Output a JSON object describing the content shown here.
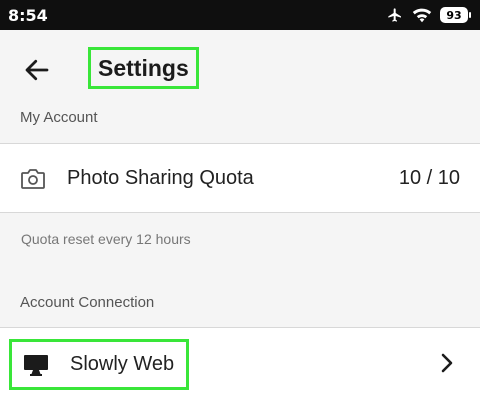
{
  "status_bar": {
    "time": "8:54",
    "battery": "93",
    "icons": [
      "airplane-icon",
      "wifi-icon",
      "battery-icon"
    ]
  },
  "header": {
    "title": "Settings",
    "back_icon": "back-arrow-icon"
  },
  "sections": {
    "my_account": {
      "label": "My Account",
      "quota_row": {
        "icon": "camera-icon",
        "label": "Photo Sharing Quota",
        "value": "10 / 10"
      },
      "note": "Quota reset every 12 hours"
    },
    "account_connection": {
      "label": "Account Connection",
      "web_row": {
        "icon": "monitor-icon",
        "label": "Slowly Web",
        "chevron": "chevron-right-icon"
      }
    }
  },
  "colors": {
    "highlight": "#39e639",
    "status_bar": "#0f0f0f",
    "background": "#f5f5f5"
  }
}
